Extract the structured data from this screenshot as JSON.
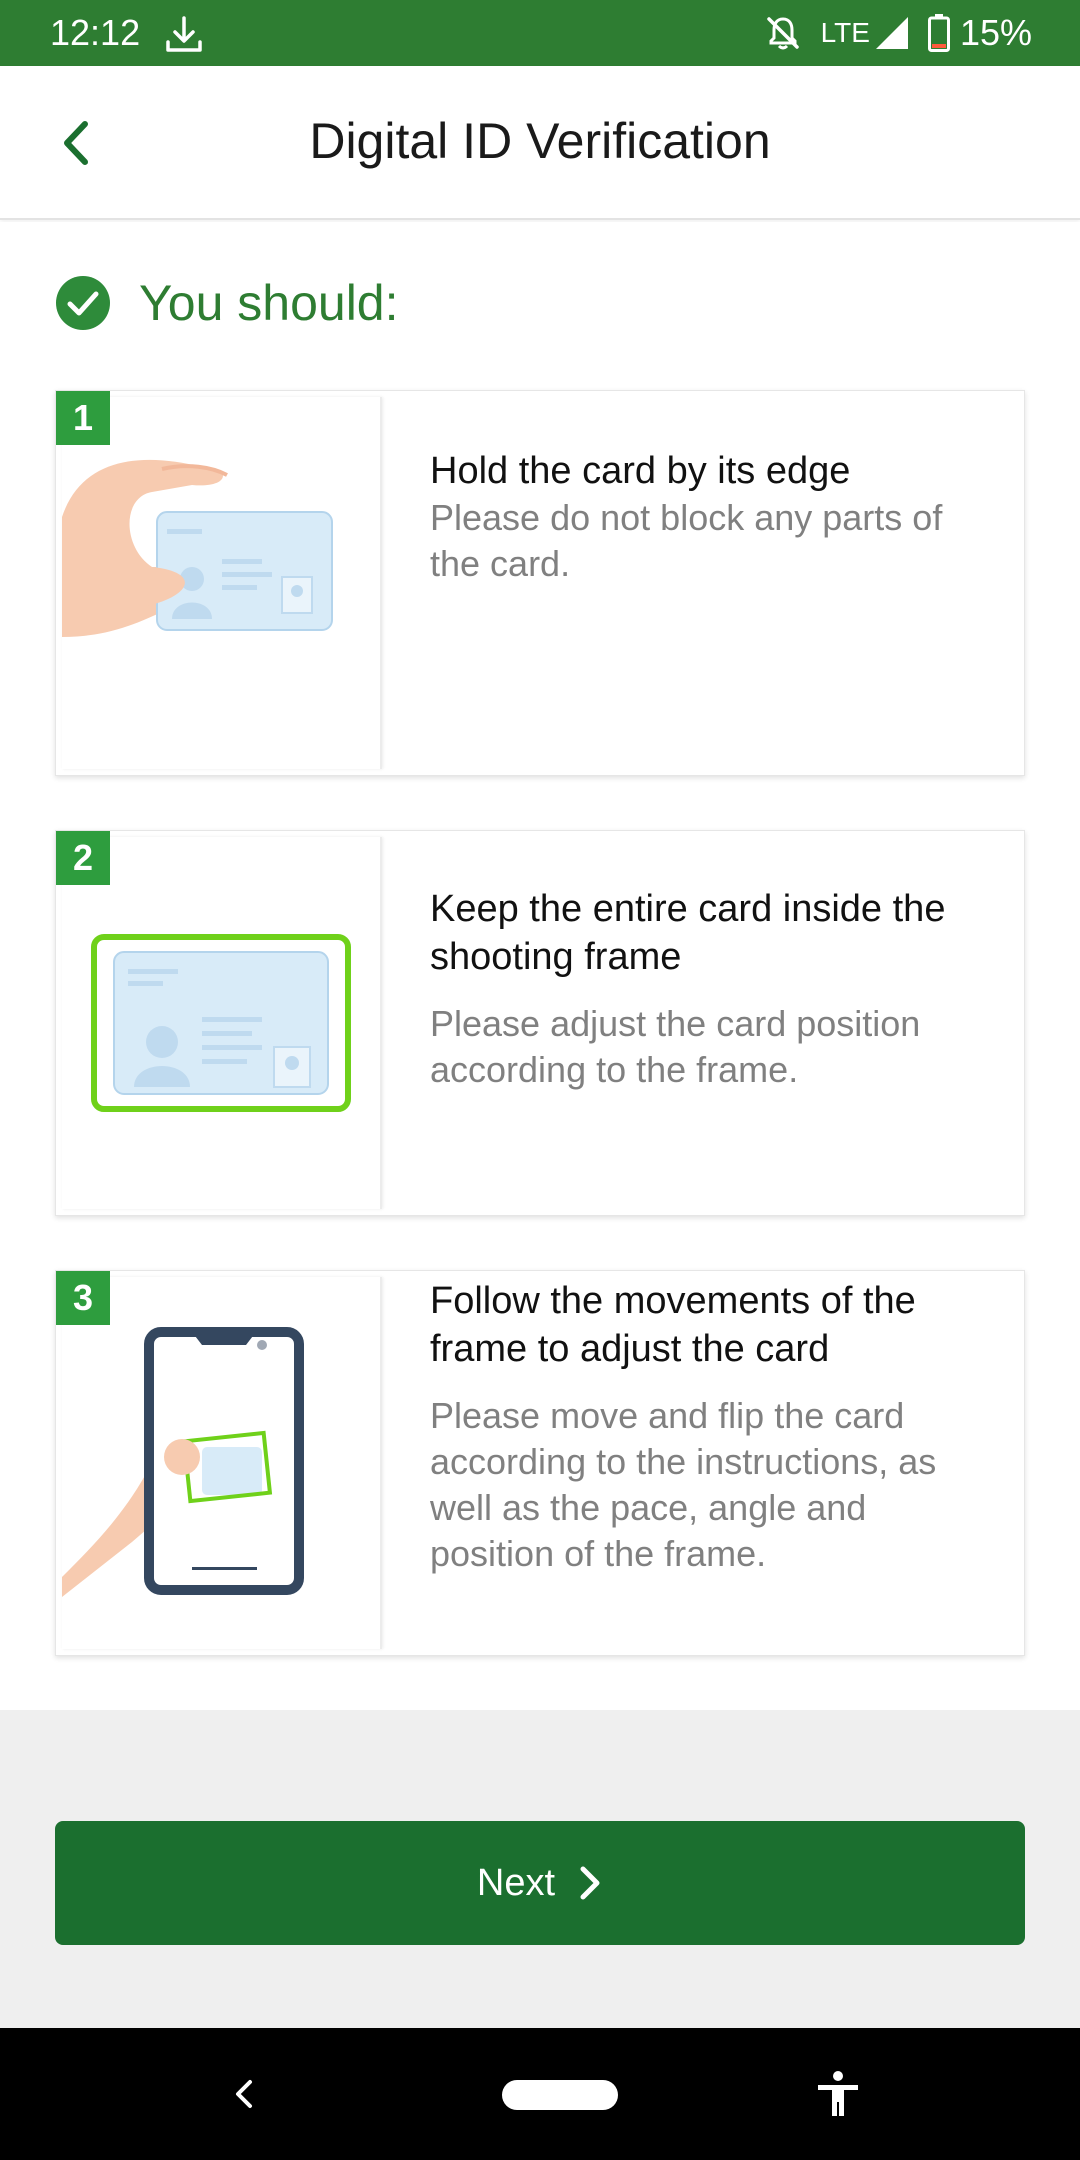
{
  "status_bar": {
    "time": "12:12",
    "network": "LTE",
    "battery": "15%",
    "icons": [
      "download-icon",
      "notifications-off-icon",
      "signal-icon",
      "battery-icon"
    ]
  },
  "app_bar": {
    "title": "Digital ID Verification",
    "back_icon": "chevron-left-icon"
  },
  "content": {
    "heading": "You should:",
    "steps": [
      {
        "number": "1",
        "title": "Hold the card by its edge",
        "description": "Please do not block any parts of the card."
      },
      {
        "number": "2",
        "title": "Keep the entire card inside the shooting frame",
        "description": "Please adjust the card position according to the frame."
      },
      {
        "number": "3",
        "title": "Follow the movements of the frame to adjust the card",
        "description": "Please move and flip the card according to the instructions, as well as the pace, angle and position of the frame."
      }
    ]
  },
  "footer": {
    "next_label": "Next"
  },
  "colors": {
    "primary_green": "#2e7d32",
    "button_green": "#1b6f2f",
    "badge_green": "#2e9d3e",
    "frame_green": "#6fd11a"
  }
}
